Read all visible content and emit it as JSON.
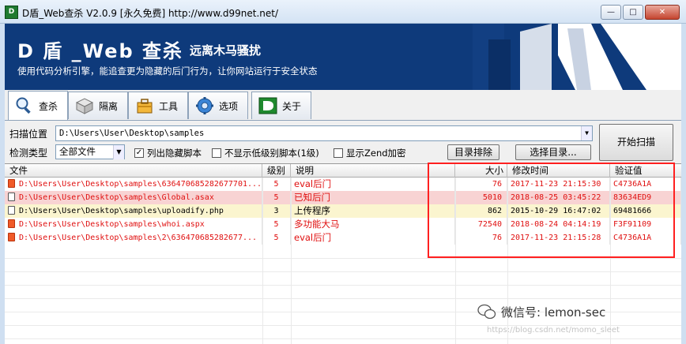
{
  "window": {
    "title": "D盾_Web查杀 V2.0.9 [永久免费] http://www.d99net.net/",
    "min_symbol": "—",
    "max_symbol": "□",
    "close_symbol": "✕"
  },
  "banner": {
    "title": "D 盾 _Web 查杀",
    "subtitle": "远离木马骚扰",
    "description": "使用代码分析引擎，能追查更为隐藏的后门行为，让你网站运行于安全状态"
  },
  "tabs": [
    {
      "label": "查杀",
      "icon": "magnifier-icon"
    },
    {
      "label": "隔离",
      "icon": "box-icon"
    },
    {
      "label": "工具",
      "icon": "toolbox-icon"
    },
    {
      "label": "选项",
      "icon": "gear-icon"
    },
    {
      "label": "关于",
      "icon": "d-logo-icon"
    }
  ],
  "controls": {
    "scan_location_label": "扫描位置",
    "scan_location_value": "D:\\Users\\User\\Desktop\\samples",
    "detect_type_label": "检测类型",
    "detect_type_value": "全部文件",
    "options": [
      {
        "label": "列出隐藏脚本",
        "checked": true
      },
      {
        "label": "不显示低级别脚本(1级)",
        "checked": false
      },
      {
        "label": "显示Zend加密",
        "checked": false
      }
    ],
    "dir_exclude_button": "目录排除",
    "select_dir_button": "选择目录...",
    "start_scan_button": "开始扫描"
  },
  "table": {
    "columns": [
      "文件",
      "级别",
      "说明",
      "大小",
      "修改时间",
      "验证值"
    ],
    "rows": [
      {
        "file": "D:\\Users\\User\\Desktop\\samples\\636470685282677701...",
        "level": "5",
        "desc": "eval后门",
        "size": "76",
        "mtime": "2017-11-23 21:15:30",
        "hash": "C4736A1A",
        "style": "red"
      },
      {
        "file": "D:\\Users\\User\\Desktop\\samples\\Global.asax",
        "level": "5",
        "desc": "已知后门",
        "size": "5010",
        "mtime": "2018-08-25 03:45:22",
        "hash": "83634ED9",
        "style": "pink"
      },
      {
        "file": "D:\\Users\\User\\Desktop\\samples\\uploadify.php",
        "level": "3",
        "desc": "上传程序",
        "size": "862",
        "mtime": "2015-10-29 16:47:02",
        "hash": "69481666",
        "style": "yellow"
      },
      {
        "file": "D:\\Users\\User\\Desktop\\samples\\whoi.aspx",
        "level": "5",
        "desc": "多功能大马",
        "size": "72540",
        "mtime": "2018-08-24 04:14:19",
        "hash": "F3F91109",
        "style": "red"
      },
      {
        "file": "D:\\Users\\User\\Desktop\\samples\\2\\636470685282677...",
        "level": "5",
        "desc": "eval后门",
        "size": "76",
        "mtime": "2017-11-23 21:15:28",
        "hash": "C4736A1A",
        "style": "red"
      }
    ]
  },
  "watermark": {
    "text": "微信号: lemon-sec",
    "url": "https://blog.csdn.net/momo_sleet"
  },
  "colors": {
    "banner_bg": "#0e3a7b",
    "danger_text": "#e01010",
    "pink_row": "#f8d3d3",
    "yellow_row": "#fbf5cf",
    "highlight_box": "#ff2020"
  }
}
